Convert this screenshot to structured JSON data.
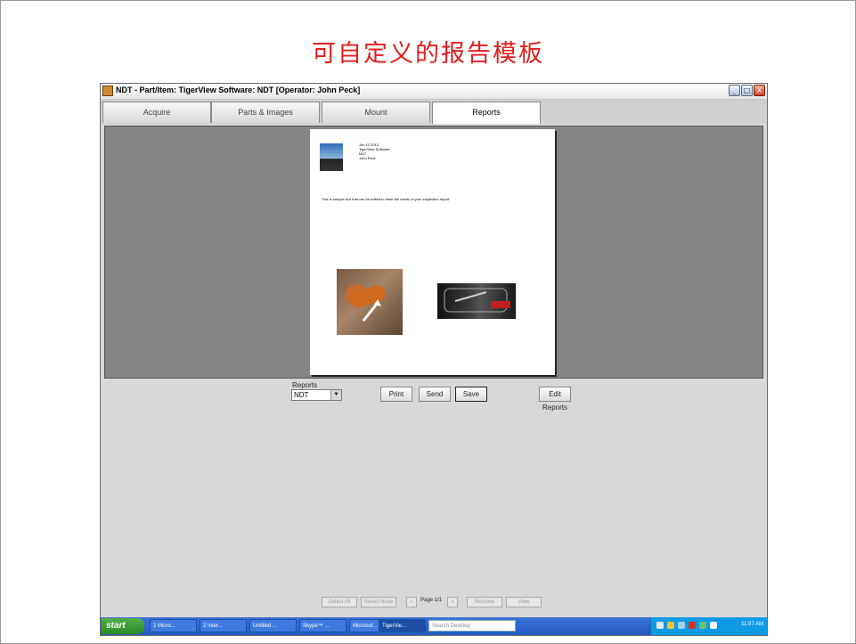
{
  "slide": {
    "title": "可自定义的报告模板"
  },
  "window": {
    "title": "NDT - Part/Item: TigerView Software: NDT [Operator: John Peck]",
    "buttons": {
      "minimize": "_",
      "maximize": "□",
      "close": "X"
    }
  },
  "tabs": [
    {
      "label": "Acquire"
    },
    {
      "label": "Parts & Images"
    },
    {
      "label": "Mount"
    },
    {
      "label": "Reports",
      "active": true
    }
  ],
  "report_page": {
    "header_lines": [
      "Jun 12 2012",
      "TigerView Software",
      "NDT",
      "John Peck"
    ],
    "body_text": "This is sample text that can be edited to meet the needs of your inspection report."
  },
  "controls": {
    "reports_label": "Reports",
    "reports_value": "NDT",
    "print": "Print",
    "send": "Send",
    "save": "Save",
    "edit_reports": "Edit Reports"
  },
  "pagination": {
    "select_all": "Select All",
    "select_none": "Select None",
    "prev": "<",
    "page": "Page 1/1",
    "next": ">",
    "remove": "Remove",
    "view": "View"
  },
  "taskbar": {
    "start": "start",
    "tasks": [
      "2 Micro...",
      "2 Inter...",
      "Untitled ...",
      "Skype™ ...",
      "Microsof...",
      "TigerVie..."
    ],
    "search_placeholder": "Search Desktop",
    "clock": "11:57 AM"
  },
  "colors": {
    "slide_title": "#e41e1e",
    "taskbar": "#245bc4",
    "start": "#2c8a26"
  }
}
